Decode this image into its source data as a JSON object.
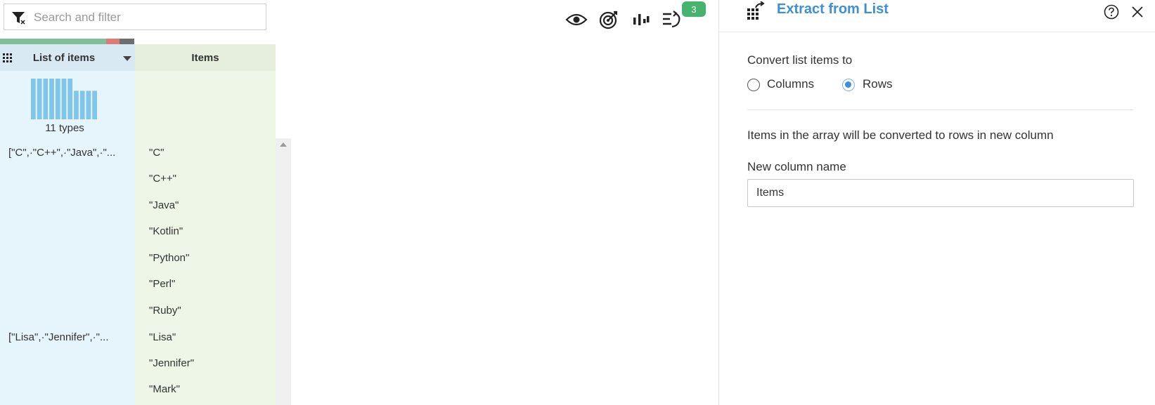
{
  "search": {
    "placeholder": "Search and filter"
  },
  "quality_bar": {
    "segments": [
      {
        "share": 0.79,
        "color": "#7fbf9a"
      },
      {
        "share": 0.1,
        "color": "#e07a72"
      },
      {
        "share": 0.11,
        "color": "#6e6e6e"
      }
    ]
  },
  "grid": {
    "columns": [
      {
        "label": "List of items"
      },
      {
        "label": "Items"
      }
    ],
    "profile": {
      "types_label": "11 types",
      "histogram": {
        "color": "#7fc6ea",
        "values": [
          1,
          1,
          1,
          1,
          1,
          1,
          1,
          0.7,
          0.7,
          0.7,
          0.7
        ]
      }
    },
    "list_cells": [
      "[\"C\",·\"C++\",·\"Java\",·\"...",
      "[\"Lisa\",·\"Jennifer\",·\"..."
    ],
    "item_cells": [
      "\"C\"",
      "\"C++\"",
      "\"Java\"",
      "\"Kotlin\"",
      "\"Python\"",
      "\"Perl\"",
      "\"Ruby\"",
      "\"Lisa\"",
      "\"Jennifer\"",
      "\"Mark\""
    ]
  },
  "toolbar": {
    "icons": [
      "eye-icon",
      "target-icon",
      "column-chart-icon",
      "recipe-steps-icon"
    ],
    "badge_count": "3",
    "badge_color": "#46b46e"
  },
  "panel": {
    "title": "Extract from List",
    "title_color": "#3d8fd6",
    "convert_label": "Convert list items to",
    "options": [
      {
        "label": "Columns",
        "selected": false
      },
      {
        "label": "Rows",
        "selected": true
      }
    ],
    "description": "Items in the array will be converted to rows in new column",
    "new_column_label": "New column name",
    "new_column_value": "Items"
  }
}
